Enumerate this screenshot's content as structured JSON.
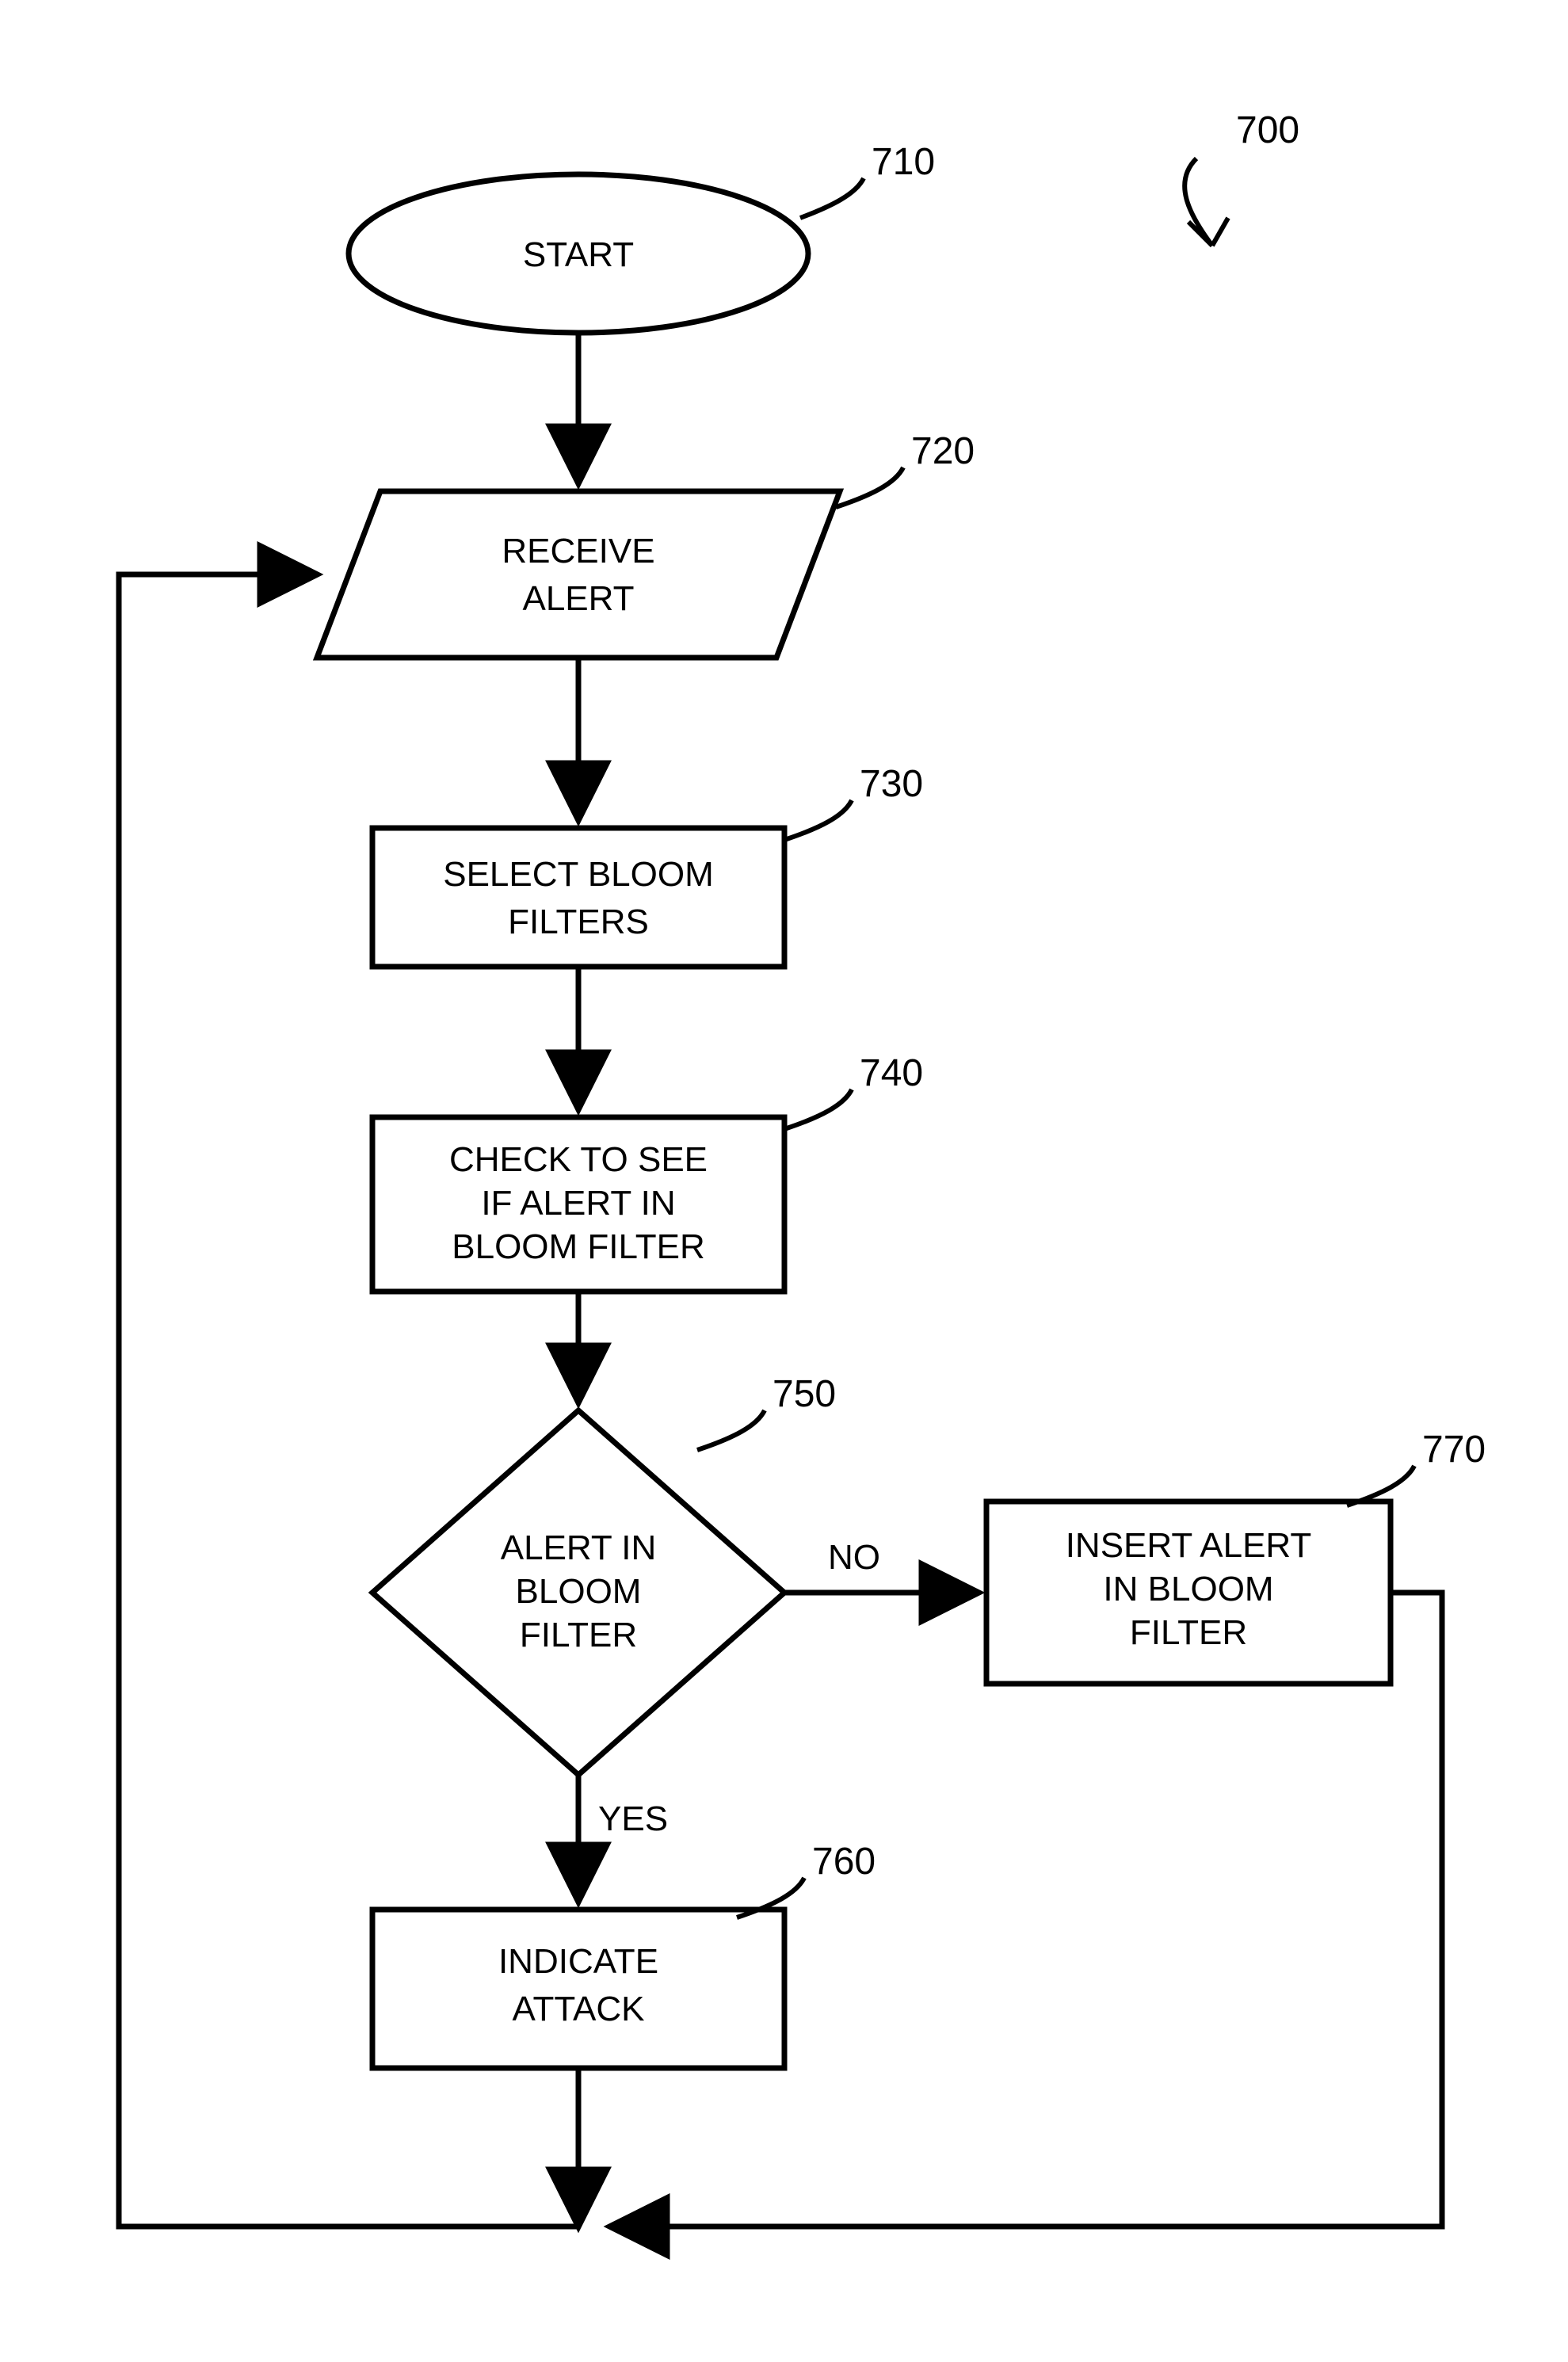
{
  "figure_ref": "700",
  "nodes": {
    "start": {
      "ref": "710",
      "text": "START"
    },
    "receive": {
      "ref": "720",
      "line1": "RECEIVE",
      "line2": "ALERT"
    },
    "select": {
      "ref": "730",
      "line1": "SELECT BLOOM",
      "line2": "FILTERS"
    },
    "check": {
      "ref": "740",
      "line1": "CHECK TO SEE",
      "line2": "IF ALERT IN",
      "line3": "BLOOM FILTER"
    },
    "decision": {
      "ref": "750",
      "line1": "ALERT IN",
      "line2": "BLOOM",
      "line3": "FILTER"
    },
    "indicate": {
      "ref": "760",
      "line1": "INDICATE",
      "line2": "ATTACK"
    },
    "insert": {
      "ref": "770",
      "line1": "INSERT ALERT",
      "line2": "IN BLOOM",
      "line3": "FILTER"
    }
  },
  "edges": {
    "yes": "YES",
    "no": "NO"
  }
}
